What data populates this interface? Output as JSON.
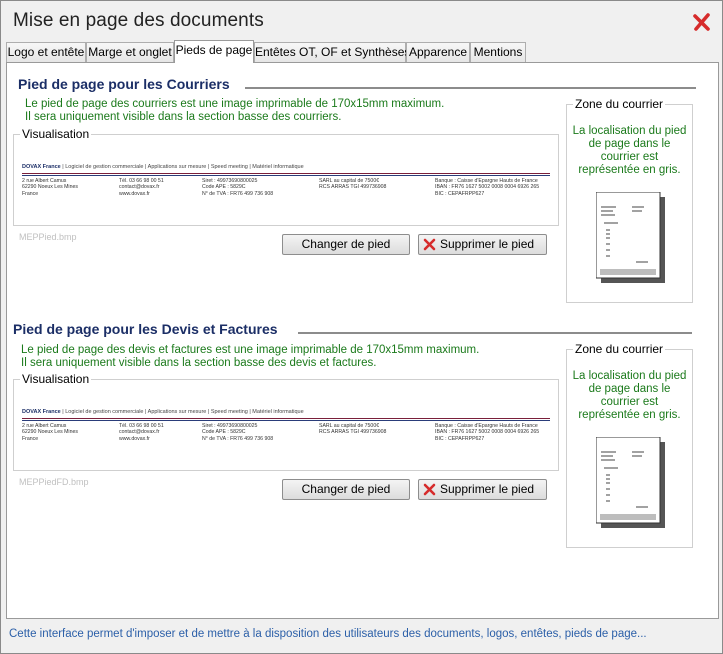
{
  "window": {
    "title": "Mise en page des documents"
  },
  "tabs": [
    {
      "label": "Logo et entête"
    },
    {
      "label": "Marge et onglet"
    },
    {
      "label": "Pieds de page"
    },
    {
      "label": "Entêtes OT, OF et Synthèses"
    },
    {
      "label": "Apparence"
    },
    {
      "label": "Mentions"
    }
  ],
  "sections": [
    {
      "title": "Pied de page pour les Courriers",
      "description_line1": "Le pied de page des courriers est une image imprimable de 170x15mm maximum.",
      "description_line2": "Il sera uniquement visible dans la section basse des courriers.",
      "preview_label": "Visualisation",
      "file_name": "MEPPied.bmp",
      "change_button": "Changer de pied",
      "delete_button": "Supprimer le pied",
      "zone_label": "Zone du courrier",
      "zone_text": "La localisation du pied de page dans le courrier est représentée en gris."
    },
    {
      "title": "Pied de page pour les Devis et Factures",
      "description_line1": "Le pied de page des devis et factures est une image imprimable de 170x15mm maximum.",
      "description_line2": "Il sera uniquement visible dans la section basse des devis et factures.",
      "preview_label": "Visualisation",
      "file_name": "MEPPiedFD.bmp",
      "change_button": "Changer de pied",
      "delete_button": "Supprimer le pied",
      "zone_label": "Zone du courrier",
      "zone_text": "La localisation du pied de page dans le courrier est représentée en gris."
    }
  ],
  "footer_preview": {
    "brand": "DOVAX France",
    "taglines": "|  Logiciel de gestion commerciale  |  Applications sur mesure  |  Speed meeting  |  Matériel informatique",
    "col1": [
      "2 rue Albert Camus",
      "62290 Noeux Les Mines",
      "France"
    ],
    "col2": [
      "Tél. 03 66 98 00 51",
      "contact@dovax.fr",
      "www.dovax.fr"
    ],
    "col3": [
      "Siret : 49973690800025",
      "Code APE : 5829C",
      "N° de TVA : FR76 499 736 908"
    ],
    "col4": [
      "SARL au capital de 7500€",
      "RCS ARRAS TGI 499736908"
    ],
    "col5": [
      "Banque : Caisse d'Epargne Hauts de France",
      "IBAN : FR76 1627 5002 0008 0004 6926 265",
      "BIC : CEPAFRPP627"
    ]
  },
  "status_bar": {
    "text": "Cette interface permet d'imposer et de mettre à la disposition des utilisateurs des documents, logos, entêtes, pieds de page..."
  },
  "colors": {
    "section_title": "#1b2e66",
    "description": "#1b7a1b",
    "status_text": "#2b5fa8",
    "close_icon": "#d62b2b"
  },
  "icons": {
    "close": "close-icon",
    "delete": "red-x-icon"
  }
}
